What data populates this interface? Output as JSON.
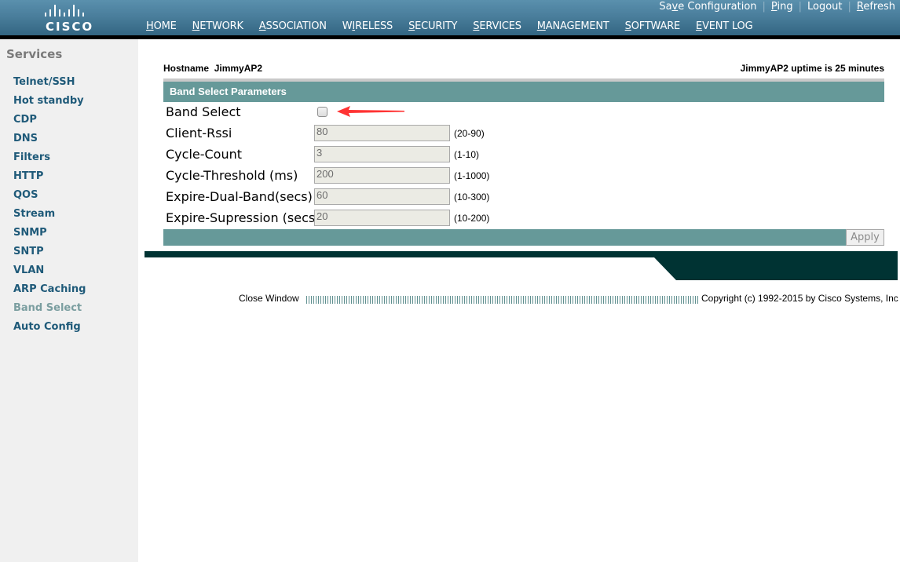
{
  "brand": {
    "logo_text": "CISCO",
    "icon": "cisco-bridge-logo"
  },
  "utility_links": [
    {
      "label": "Save Configuration",
      "accesskey": "v"
    },
    {
      "label": "Ping",
      "accesskey": "P"
    },
    {
      "label": "Logout",
      "accesskey": ""
    },
    {
      "label": "Refresh",
      "accesskey": "R"
    }
  ],
  "nav": {
    "tabs": [
      {
        "label": "HOME",
        "first": "H",
        "rest": "OME"
      },
      {
        "label": "NETWORK",
        "first": "N",
        "rest": "ETWORK"
      },
      {
        "label": "ASSOCIATION",
        "first": "A",
        "rest": "SSOCIATION"
      },
      {
        "label": "WIRELESS",
        "pre": "W",
        "first": "I",
        "rest": "RELESS"
      },
      {
        "label": "SECURITY",
        "first": "S",
        "rest": "ECURITY"
      },
      {
        "label": "SERVICES",
        "first": "S",
        "rest": "ERVICES"
      },
      {
        "label": "MANAGEMENT",
        "first": "M",
        "rest": "ANAGEMENT"
      },
      {
        "label": "SOFTWARE",
        "first": "S",
        "rest": "OFTWARE"
      },
      {
        "label": "EVENT LOG",
        "first": "E",
        "rest": "VENT LOG"
      }
    ],
    "active": "SERVICES",
    "active_color": "#f7941d"
  },
  "sidebar": {
    "title": "Services",
    "items": [
      {
        "label": "Telnet/SSH"
      },
      {
        "label": "Hot standby"
      },
      {
        "label": "CDP"
      },
      {
        "label": "DNS"
      },
      {
        "label": "Filters"
      },
      {
        "label": "HTTP"
      },
      {
        "label": "QOS"
      },
      {
        "label": "Stream"
      },
      {
        "label": "SNMP"
      },
      {
        "label": "SNTP"
      },
      {
        "label": "VLAN"
      },
      {
        "label": "ARP Caching"
      },
      {
        "label": "Band Select",
        "active": true
      },
      {
        "label": "Auto Config"
      }
    ]
  },
  "main": {
    "hostname_label": "Hostname",
    "hostname": "JimmyAP2",
    "uptime": "JimmyAP2 uptime is 25 minutes",
    "section_title": "Band Select Parameters",
    "band_select": {
      "label": "Band Select",
      "checked": false
    },
    "params": [
      {
        "label": "Client-Rssi",
        "value": "80",
        "range": "(20-90)"
      },
      {
        "label": "Cycle-Count",
        "value": "3",
        "range": "(1-10)"
      },
      {
        "label": "Cycle-Threshold (ms)",
        "value": "200",
        "range": "(1-1000)"
      },
      {
        "label": "Expire-Dual-Band(secs)",
        "value": "60",
        "range": "(10-300)"
      },
      {
        "label": "Expire-Supression (secs)",
        "value": "20",
        "range": "(10-200)"
      }
    ],
    "apply_label": "Apply",
    "section_color": "#669999"
  },
  "footer": {
    "close_window": "Close Window",
    "copyright": "Copyright (c) 1992-2015 by Cisco Systems, Inc"
  },
  "annotation": {
    "icon": "red-arrow-icon",
    "color": "#ff3333"
  }
}
